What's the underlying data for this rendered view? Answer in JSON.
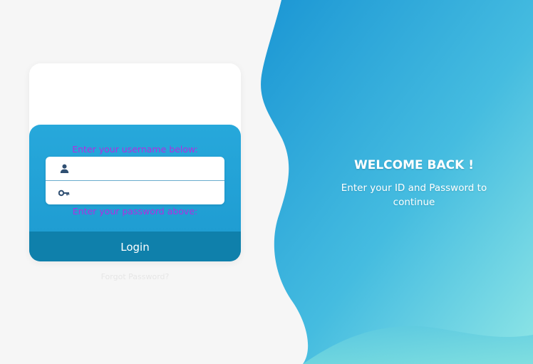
{
  "login_card": {
    "username_hint": "Enter your username below:",
    "password_hint": "Enter your password above:",
    "username_placeholder": "",
    "password_placeholder": "",
    "login_label": "Login",
    "forgot_label": "Forgot Password?"
  },
  "welcome": {
    "title": "WELCOME BACK !",
    "subtitle": "Enter your ID and Password to continue"
  },
  "icons": {
    "username": "user-icon",
    "password": "key-icon"
  },
  "colors": {
    "card_blue": "#1d9ad0",
    "login_button": "#0f80ab",
    "hint_text": "#b02ee0",
    "panel_top": "#1b96d4",
    "panel_bottom": "#8fe6e6"
  }
}
